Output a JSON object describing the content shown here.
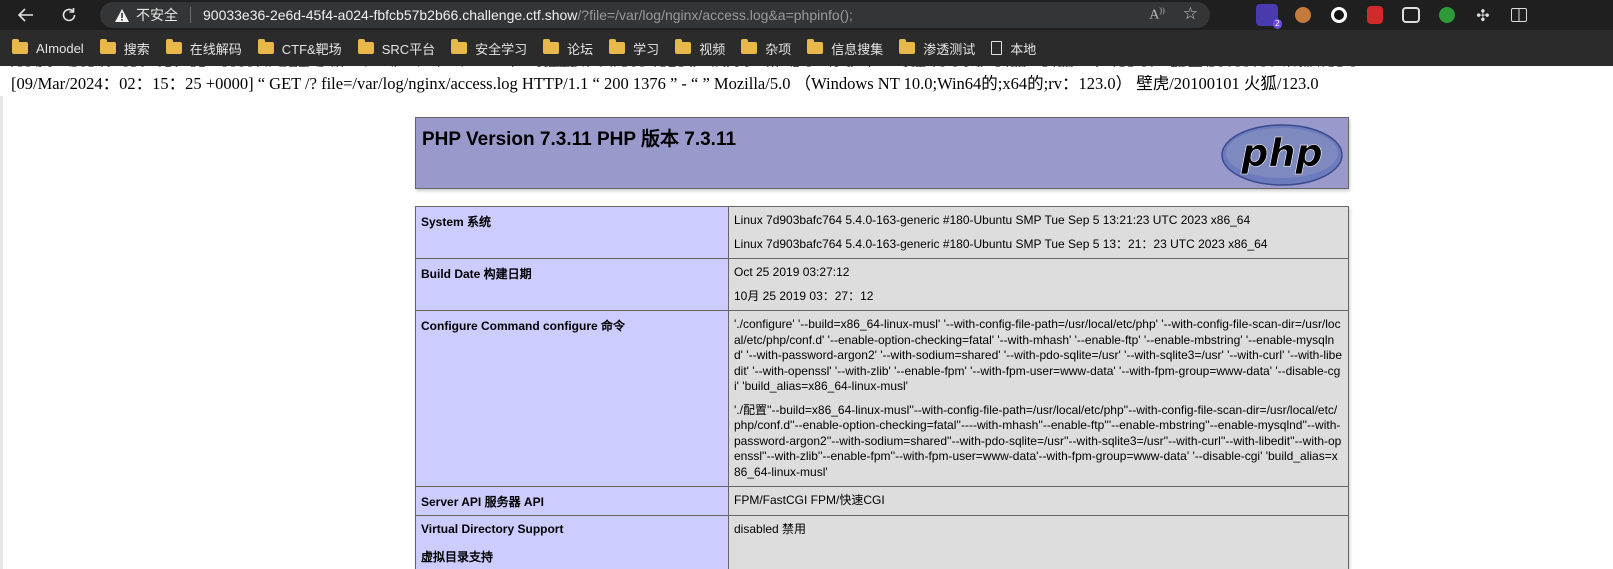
{
  "browser": {
    "security_label": "不安全",
    "url_host": "90033e36-2e6d-45f4-a024-fbfcb57b2b66.challenge.ctf.show",
    "url_path": "/?file=/var/log/nginx/access.log&a=phpinfo();",
    "extension_badge": "2"
  },
  "bookmarks": [
    {
      "label": "AImodel",
      "icon": "folder-icon"
    },
    {
      "label": "搜索",
      "icon": "folder-icon"
    },
    {
      "label": "在线解码",
      "icon": "folder-icon"
    },
    {
      "label": "CTF&靶场",
      "icon": "folder-icon"
    },
    {
      "label": "SRC平台",
      "icon": "folder-icon"
    },
    {
      "label": "安全学习",
      "icon": "folder-icon"
    },
    {
      "label": "论坛",
      "icon": "folder-icon"
    },
    {
      "label": "学习",
      "icon": "folder-icon"
    },
    {
      "label": "视频",
      "icon": "folder-icon"
    },
    {
      "label": "杂项",
      "icon": "folder-icon"
    },
    {
      "label": "信息搜集",
      "icon": "folder-icon"
    },
    {
      "label": "渗透测试",
      "icon": "folder-icon"
    },
    {
      "label": "本地",
      "icon": "document-icon"
    }
  ],
  "log": {
    "line": "[09/Mar/2024：02：15：25 +0000] “ GET /? file=/var/log/nginx/access.log HTTP/1.1 “ 200 1376 ” - “ ” Mozilla/5.0 （Windows NT 10.0;Win64的;x64的;rv：123.0） 壁虎/20100101 火狐/123.0"
  },
  "phpinfo": {
    "title": "PHP Version 7.3.11 PHP 版本 7.3.11",
    "logo_text": "php",
    "rows": [
      {
        "key": "System  系统",
        "values": [
          "Linux 7d903bafc764 5.4.0-163-generic #180-Ubuntu SMP Tue Sep 5 13:21:23 UTC 2023 x86_64",
          "Linux 7d903bafc764 5.4.0-163-generic #180-Ubuntu SMP Tue Sep 5 13：21：23 UTC 2023 x86_64"
        ]
      },
      {
        "key": "Build Date  构建日期",
        "values": [
          "Oct 25 2019 03:27:12",
          "10月 25 2019 03：27：12"
        ]
      },
      {
        "key": "Configure Command  configure 命令",
        "values": [
          "'./configure' '--build=x86_64-linux-musl' '--with-config-file-path=/usr/local/etc/php' '--with-config-file-scan-dir=/usr/local/etc/php/conf.d' '--enable-option-checking=fatal' '--with-mhash' '--enable-ftp' '--enable-mbstring' '--enable-mysqlnd' '--with-password-argon2' '--with-sodium=shared' '--with-pdo-sqlite=/usr' '--with-sqlite3=/usr' '--with-curl' '--with-libedit' '--with-openssl' '--with-zlib' '--enable-fpm' '--with-fpm-user=www-data' '--with-fpm-group=www-data' '--disable-cgi' 'build_alias=x86_64-linux-musl'",
          "'./配置''--build=x86_64-linux-musl''--with-config-file-path=/usr/local/etc/php''--with-config-file-scan-dir=/usr/local/etc/php/conf.d''--enable-option-checking=fatal''----with-mhash''--enable-ftp'''--enable-mbstring''--enable-mysqlnd''--with-password-argon2''--with-sodium=shared''--with-pdo-sqlite=/usr''--with-sqlite3=/usr''--with-curl''--with-libedit''--with-openssl''--with-zlib''--enable-fpm''--with-fpm-user=www-data'--with-fpm-group=www-data' '--disable-cgi' 'build_alias=x86_64-linux-musl'"
        ]
      },
      {
        "key": "Server API  服务器 API",
        "values": [
          "FPM/FastCGI  FPM/快速CGI"
        ]
      },
      {
        "key": "Virtual Directory Support",
        "key2": "虚拟目录支持",
        "values": [
          "disabled  禁用"
        ]
      }
    ]
  },
  "colors": {
    "chrome_bg": "#1f1f1f",
    "bookmark_bg": "#2b2b2b",
    "php_header": "#9999cc",
    "php_key": "#ccccff",
    "php_value": "#dddddd"
  }
}
